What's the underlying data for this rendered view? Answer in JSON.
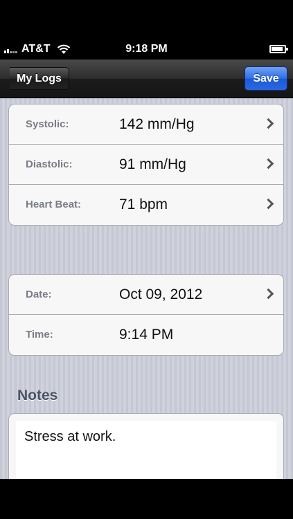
{
  "status_bar": {
    "carrier": "AT&T",
    "time": "9:18 PM"
  },
  "nav": {
    "back_label": "My Logs",
    "save_label": "Save"
  },
  "vitals": [
    {
      "label": "Systolic:",
      "value": "142 mm/Hg"
    },
    {
      "label": "Diastolic:",
      "value": "91 mm/Hg"
    },
    {
      "label": "Heart Beat:",
      "value": "71 bpm"
    }
  ],
  "datetime": [
    {
      "label": "Date:",
      "value": "Oct 09, 2012"
    },
    {
      "label": "Time:",
      "value": "9:14 PM"
    }
  ],
  "notes": {
    "title": "Notes",
    "text": "Stress at work."
  },
  "colors": {
    "accent": "#2f6fe6",
    "nav_bg": "#2d2d2d"
  }
}
